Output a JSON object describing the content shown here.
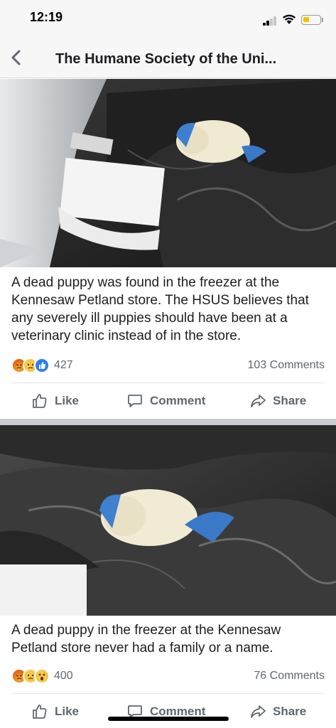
{
  "status_bar": {
    "time": "12:19",
    "battery_color": "#f5c400"
  },
  "nav": {
    "back_icon": "chevron-left-icon",
    "title": "The Humane Society of the Uni..."
  },
  "posts": [
    {
      "image_description_icon": "photo",
      "text": "A dead puppy was found in the freezer at the Kennesaw Petland store. The HSUS believes that any severely ill puppies should have been at a veterinary clinic instead of in the store.",
      "reactions": [
        "angry",
        "sad",
        "like"
      ],
      "reaction_count": "427",
      "comments": "103 Comments"
    },
    {
      "image_description_icon": "photo",
      "text": "A dead puppy in the freezer at the Kennesaw Petland store never had a family or a name.",
      "reactions": [
        "angry",
        "sad",
        "wow"
      ],
      "reaction_count": "400",
      "comments": "76 Comments"
    }
  ],
  "actions": {
    "like": "Like",
    "comment": "Comment",
    "share": "Share"
  }
}
